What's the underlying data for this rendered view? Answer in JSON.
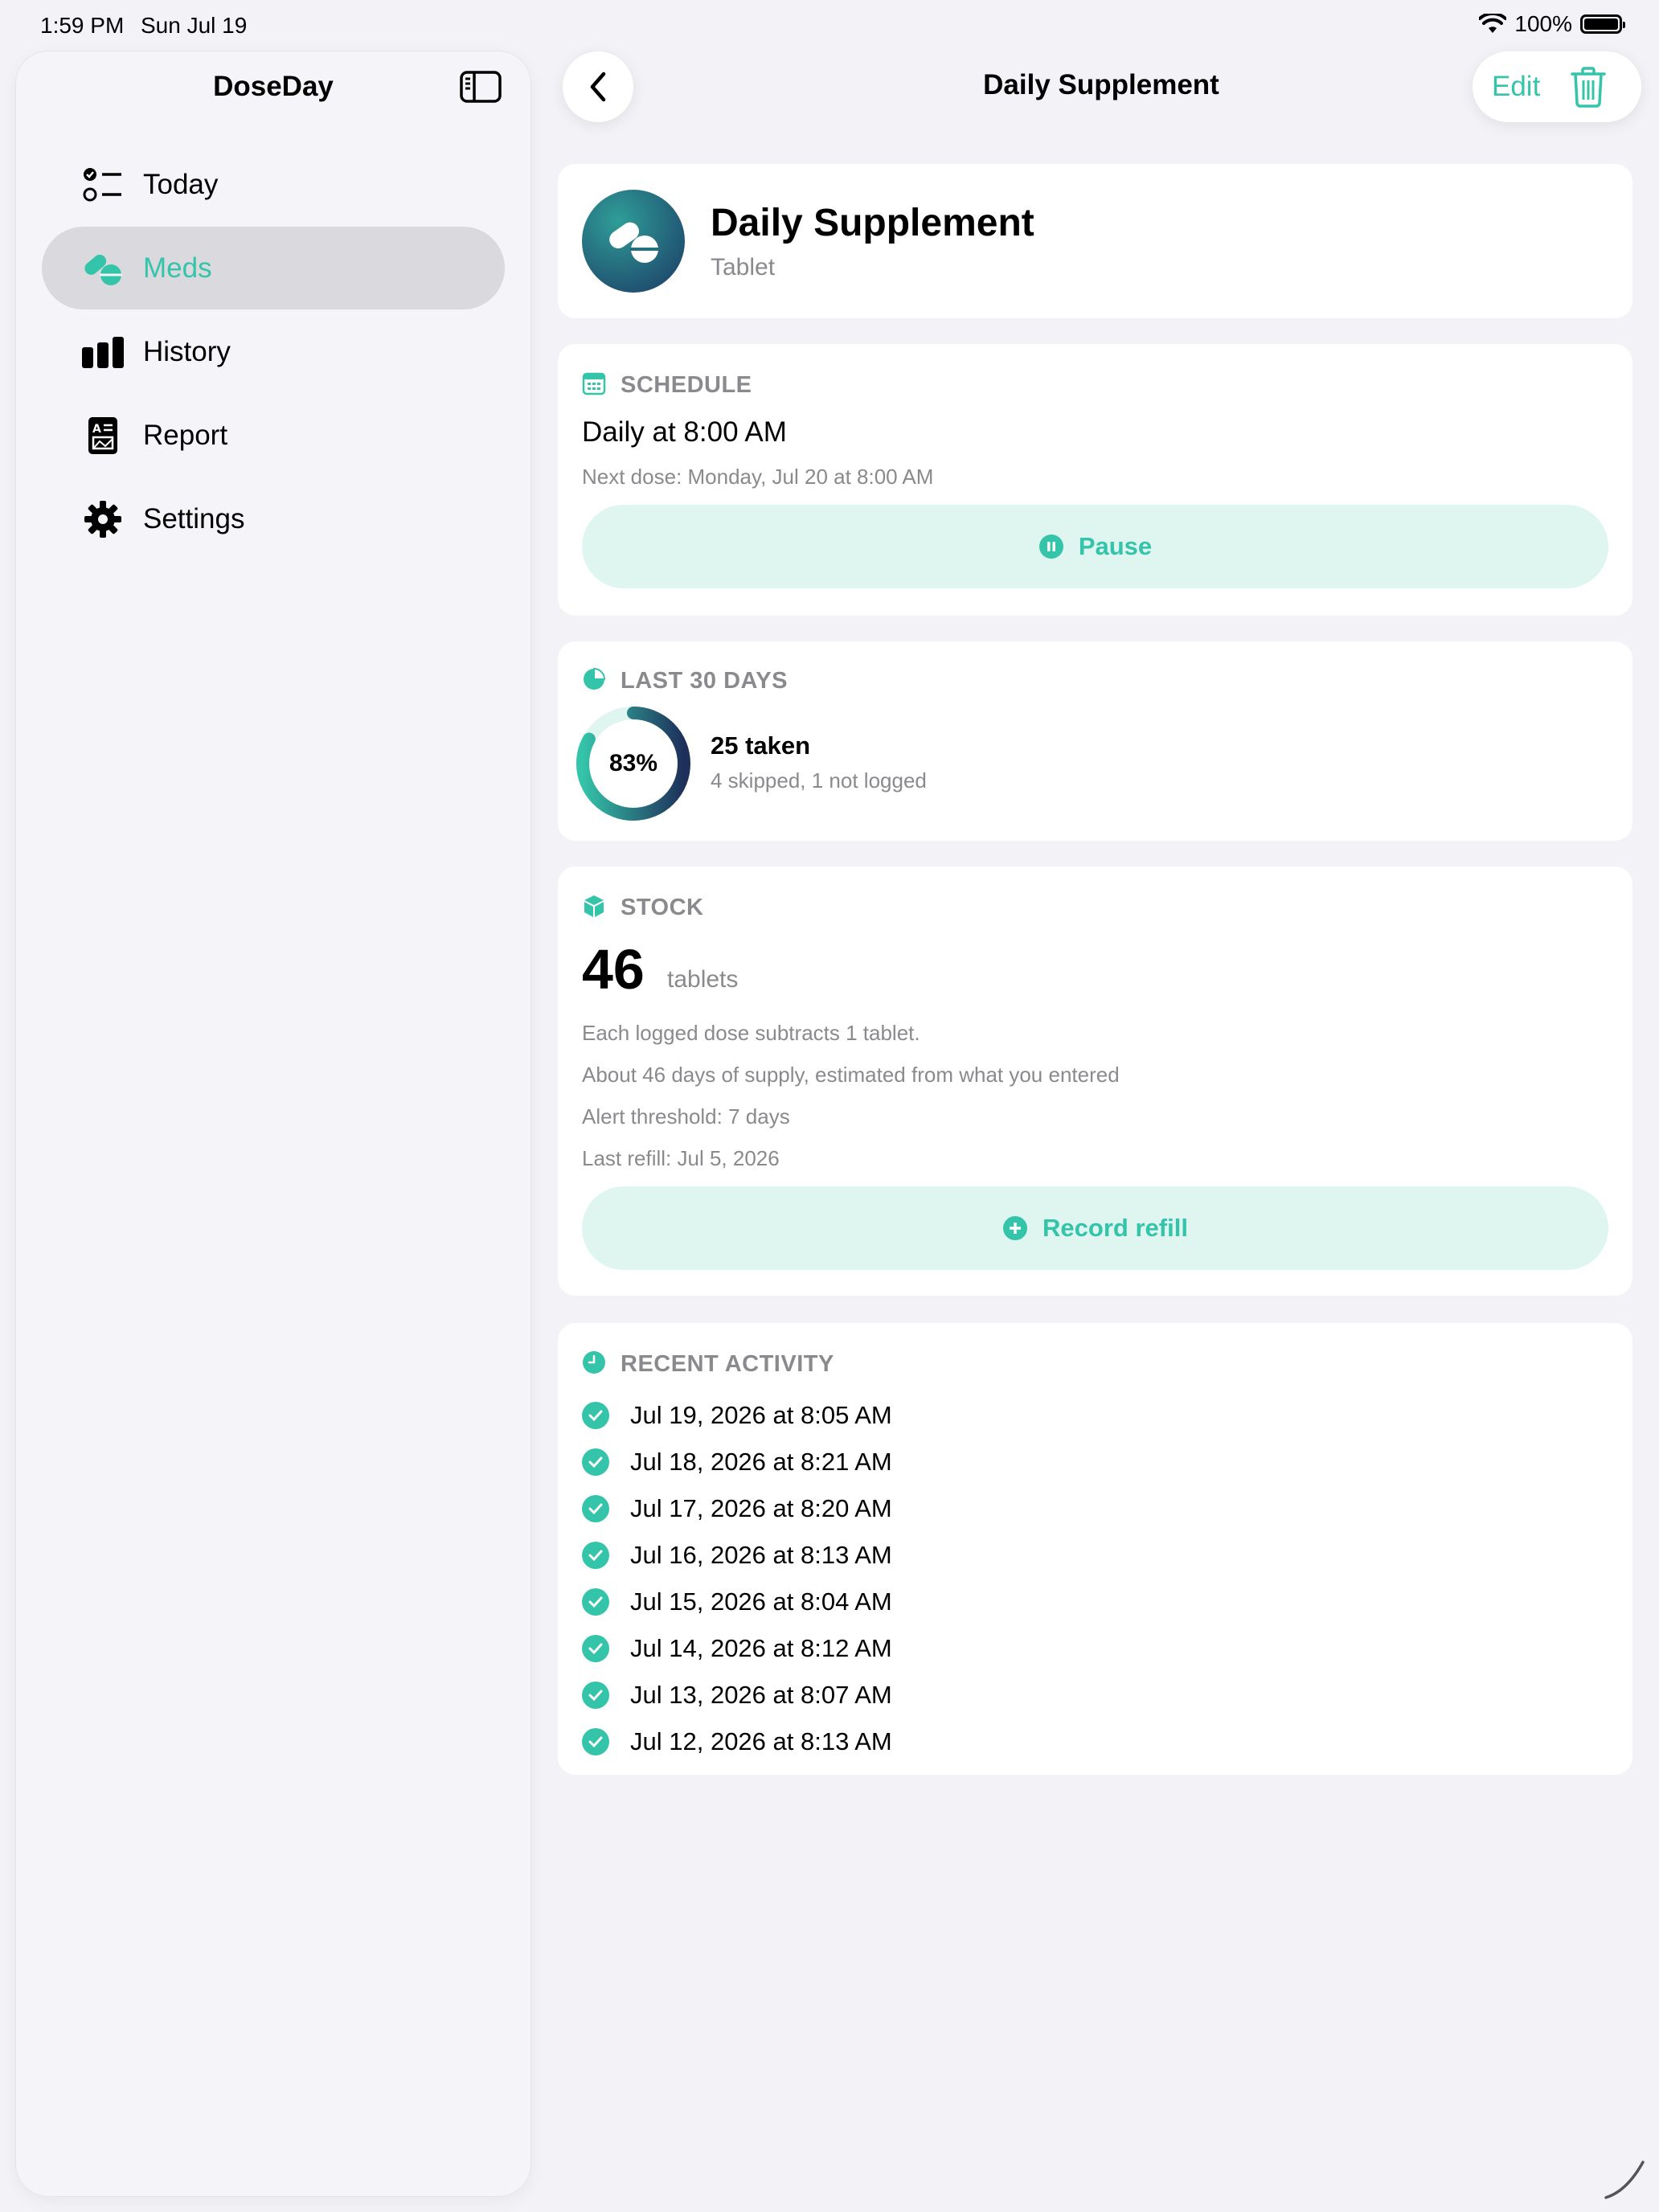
{
  "status_bar": {
    "time": "1:59 PM",
    "date": "Sun Jul 19",
    "battery": "100%"
  },
  "sidebar": {
    "title": "DoseDay",
    "items": [
      {
        "label": "Today",
        "icon": "checklist-icon",
        "active": false
      },
      {
        "label": "Meds",
        "icon": "pills-icon",
        "active": true
      },
      {
        "label": "History",
        "icon": "bar-chart-icon",
        "active": false
      },
      {
        "label": "Report",
        "icon": "report-icon",
        "active": false
      },
      {
        "label": "Settings",
        "icon": "gear-icon",
        "active": false
      }
    ]
  },
  "toolbar": {
    "title": "Daily Supplement",
    "edit_label": "Edit"
  },
  "medication": {
    "name": "Daily Supplement",
    "form": "Tablet"
  },
  "schedule": {
    "header": "SCHEDULE",
    "when": "Daily at 8:00 AM",
    "next_dose": "Next dose: Monday, Jul 20 at 8:00 AM",
    "pause_label": "Pause"
  },
  "last_30_days": {
    "header": "LAST 30 DAYS",
    "percent": "83%",
    "adherence_fraction": 0.83,
    "taken": "25 taken",
    "other": "4 skipped, 1 not logged"
  },
  "stock": {
    "header": "STOCK",
    "count": "46",
    "unit": "tablets",
    "lines": [
      "Each logged dose subtracts 1 tablet.",
      "About 46 days of supply, estimated from what you entered",
      "Alert threshold: 7 days",
      "Last refill: Jul 5, 2026"
    ],
    "refill_label": "Record refill"
  },
  "recent_activity": {
    "header": "RECENT ACTIVITY",
    "entries": [
      "Jul 19, 2026 at 8:05 AM",
      "Jul 18, 2026 at 8:21 AM",
      "Jul 17, 2026 at 8:20 AM",
      "Jul 16, 2026 at 8:13 AM",
      "Jul 15, 2026 at 8:04 AM",
      "Jul 14, 2026 at 8:12 AM",
      "Jul 13, 2026 at 8:07 AM",
      "Jul 12, 2026 at 8:13 AM"
    ]
  },
  "colors": {
    "accent": "#34c4a9",
    "accent_soft": "#dff5f0",
    "ring_dark": "#1f3a5f",
    "secondary_text": "#8a8a8e"
  }
}
